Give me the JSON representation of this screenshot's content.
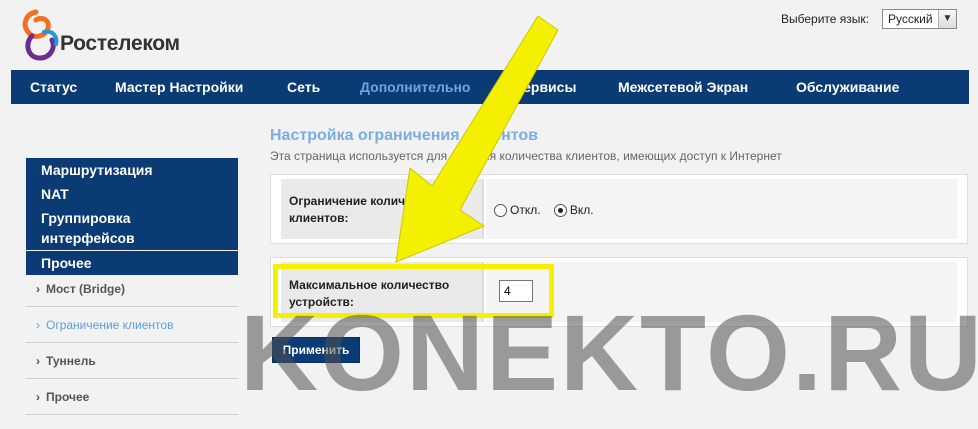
{
  "brand": {
    "name": "Ростелеком"
  },
  "language": {
    "label": "Выберите язык:",
    "selected": "Русский"
  },
  "nav": {
    "items": [
      {
        "label": "Статус"
      },
      {
        "label": "Мастер Настройки"
      },
      {
        "label": "Сеть"
      },
      {
        "label": "Дополнительно"
      },
      {
        "label": "Сервисы"
      },
      {
        "label": "Межсетевой Экран"
      },
      {
        "label": "Обслуживание"
      }
    ],
    "active": "Дополнительно"
  },
  "sidebar": {
    "sections": [
      {
        "label": "Маршрутизация"
      },
      {
        "label": "NAT"
      },
      {
        "label": "Группировка интерфейсов"
      },
      {
        "label": "Прочее"
      }
    ],
    "subitems": [
      {
        "label": "Мост (Bridge)"
      },
      {
        "label": "Ограничение клиентов"
      },
      {
        "label": "Туннель"
      },
      {
        "label": "Прочее"
      }
    ],
    "active_subitem": "Ограничение клиентов"
  },
  "main": {
    "title": "Настройка ограничения клиентов",
    "description": "Эта страница используется для задания количества клиентов, имеющих доступ к Интернет",
    "client_limit": {
      "label": "Ограничение количества клиентов:",
      "options": [
        {
          "label": "Откл."
        },
        {
          "label": "Вкл."
        }
      ],
      "selected": "Вкл."
    },
    "max_devices": {
      "label": "Максимальное количество устройств:",
      "value": "4"
    },
    "apply_label": "Применить"
  },
  "watermark": {
    "text": "KONEKTO.RU"
  },
  "colors": {
    "nav_bg": "#0a3b74",
    "active_link": "#6aa6e4",
    "title": "#7aaee3",
    "highlight": "#f4f000"
  }
}
